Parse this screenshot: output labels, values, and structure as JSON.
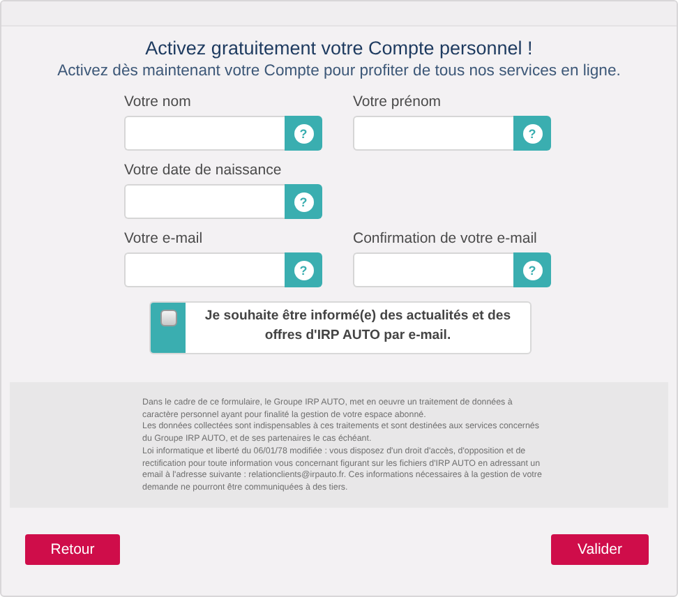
{
  "heading": {
    "title": "Activez gratuitement votre Compte personnel !",
    "subtitle": "Activez dès maintenant votre Compte pour profiter de tous nos services en ligne."
  },
  "field_rows": [
    [
      {
        "label": "Votre nom",
        "help": "?"
      },
      {
        "label": "Votre prénom",
        "help": "?"
      }
    ],
    [
      {
        "label": "Votre date de naissance",
        "help": "?"
      }
    ],
    [
      {
        "label": "Votre e-mail",
        "help": "?"
      },
      {
        "label": "Confirmation de votre e-mail",
        "help": "?"
      }
    ]
  ],
  "newsletter": {
    "checked": false,
    "label": "Je souhaite être informé(e) des actualités et des offres d'IRP AUTO par e-mail."
  },
  "legal": [
    "Dans le cadre de ce formulaire, le Groupe IRP AUTO, met en oeuvre un traitement de données à caractère personnel ayant pour finalité la gestion de votre espace abonné.",
    "Les données collectées sont indispensables à ces traitements et sont destinées aux services concernés du Groupe IRP AUTO, et de ses partenaires le cas échéant.",
    "Loi informatique et liberté du 06/01/78 modifiée : vous disposez d'un droit d'accès, d'opposition et de rectification pour toute information vous concernant figurant sur les fichiers d'IRP AUTO en adressant un email à l'adresse suivante : relationclients@irpauto.fr. Ces informations nécessaires à la gestion de votre demande ne pourront être communiquées à des tiers."
  ],
  "buttons": {
    "back": "Retour",
    "submit": "Valider"
  }
}
